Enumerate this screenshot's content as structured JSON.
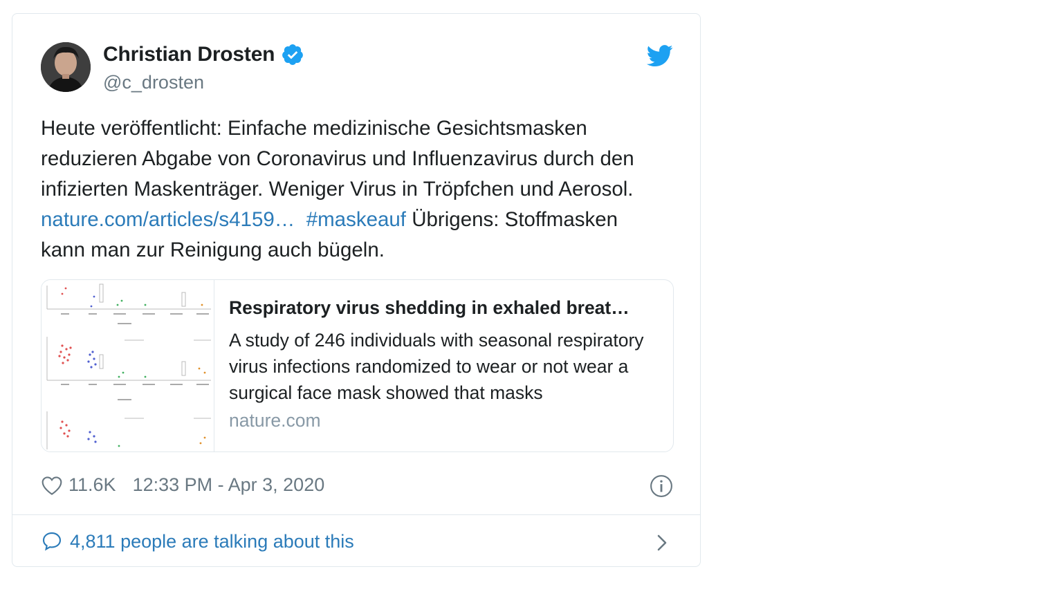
{
  "tweet": {
    "author_name": "Christian Drosten",
    "author_handle": "@c_drosten",
    "text_part1": "Heute veröffentlicht: Einfache medizinische Gesichtsmasken reduzieren Abgabe von Coronavirus und Influenzavirus durch den infizierten Maskenträger. Weniger Virus in Tröpfchen und Aerosol. ",
    "link_text": "nature.com/articles/s4159…",
    "hashtag": "#maskeauf",
    "text_part2": " Übrigens: Stoffmasken kann man zur Reinigung auch bügeln.",
    "likes": "11.6K",
    "timestamp": "12:33 PM - Apr 3, 2020",
    "footer_text": "4,811 people are talking about this"
  },
  "preview": {
    "title": "Respiratory virus shedding in exhaled breat…",
    "description": "A study of 246 individuals with seasonal respiratory virus infections randomized to wear or not wear a surgical face mask showed that masks",
    "domain": "nature.com"
  },
  "colors": {
    "link": "#2b7bb9",
    "verified": "#1da1f2",
    "twitter_bird": "#1da1f2",
    "muted": "#697882"
  },
  "icons": [
    "verified-badge-icon",
    "twitter-bird-icon",
    "heart-icon",
    "info-icon",
    "comment-bubble-icon",
    "chevron-right-icon"
  ]
}
